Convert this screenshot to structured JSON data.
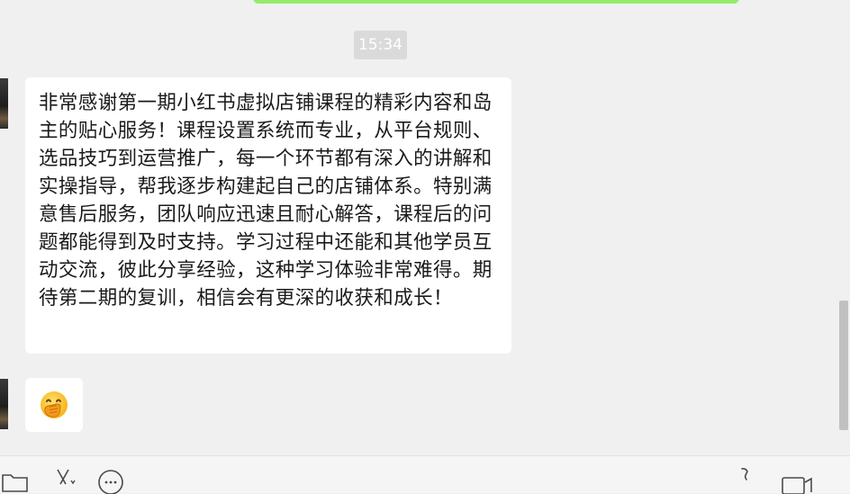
{
  "chat": {
    "timestamp": "15:34",
    "messages": [
      {
        "type": "text",
        "text": "非常感谢第一期小红书虚拟店铺课程的精彩内容和岛主的贴心服务！课程设置系统而专业，从平台规则、选品技巧到运营推广，每一个环节都有深入的讲解和实操指导，帮我逐步构建起自己的店铺体系。特别满意售后服务，团队响应迅速且耐心解答，课程后的问题都能得到及时支持。学习过程中还能和其他学员互动交流，彼此分享经验，这种学习体验非常难得。期待第二期的复训，相信会有更深的收获和成长！"
      },
      {
        "type": "emoji",
        "emoji_name": "face-with-hand-over-mouth-emoji"
      }
    ]
  },
  "toolbar": {
    "icons": [
      "folder-icon",
      "scissors-icon",
      "chat-bubble-icon",
      "phone-icon",
      "video-call-icon"
    ]
  },
  "colors": {
    "chat_background": "#f0f0f0",
    "received_bubble": "#ffffff",
    "sent_bubble": "#95ec69",
    "timestamp_pill": "#dadada"
  }
}
